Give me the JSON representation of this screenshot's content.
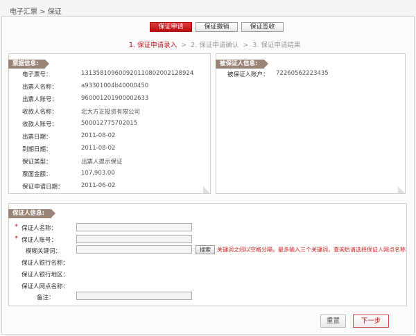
{
  "breadcrumb": "电子汇票 > 保证",
  "tabs": [
    {
      "label": "保证申请",
      "active": true
    },
    {
      "label": "保证撤销",
      "active": false
    },
    {
      "label": "保证签收",
      "active": false
    }
  ],
  "steps": [
    {
      "label": "1. 保证申请录入",
      "active": true
    },
    {
      "label": "2. 保证申请确认",
      "active": false
    },
    {
      "label": "3. 保证申请结果",
      "active": false
    }
  ],
  "step_separator": ">",
  "bill_info": {
    "title": "票据信息:",
    "rows": [
      {
        "label": "电子票号：",
        "value": "131358109600920110802002128924"
      },
      {
        "label": "出票人名称：",
        "value": "a93301004b40000450"
      },
      {
        "label": "出票人账号：",
        "value": "960001201900002633"
      },
      {
        "label": "收款人名称：",
        "value": "北大方正投资有限公司"
      },
      {
        "label": "收款人账号：",
        "value": "500012775702015"
      },
      {
        "label": "出票日期：",
        "value": "2011-08-02"
      },
      {
        "label": "到期日期：",
        "value": "2011-08-02"
      },
      {
        "label": "保证类型：",
        "value": "出票人提示保证"
      },
      {
        "label": "票面金额：",
        "value": "107,903.00"
      },
      {
        "label": "保证申请日期：",
        "value": "2011-06-02"
      }
    ]
  },
  "guaranteed_info": {
    "title": "被保证人信息:",
    "account_label": "被保证人账户：",
    "account_value": "72260562223435"
  },
  "guarantor": {
    "title": "保证人信息:",
    "name_label": "保证人名称：",
    "account_label": "保证人账号：",
    "keyword_label": "模糊关键词：",
    "bank_name_label": "保证人银行名称：",
    "bank_region_label": "保证人银行地区：",
    "branch_label": "保证人网点名称：",
    "remark_label": "备注：",
    "required_mark": "*",
    "search_button": "搜索",
    "hint": "关键词之间以空格分隔，最多输入三个关键词，查询后请选择保证人网点名称",
    "name_value": "",
    "account_value": "",
    "keyword_value": "",
    "remark_value": ""
  },
  "buttons": {
    "reset": "重置",
    "next": "下一步"
  },
  "colors": {
    "accent": "#c4121b",
    "tag": "#9a8478"
  }
}
